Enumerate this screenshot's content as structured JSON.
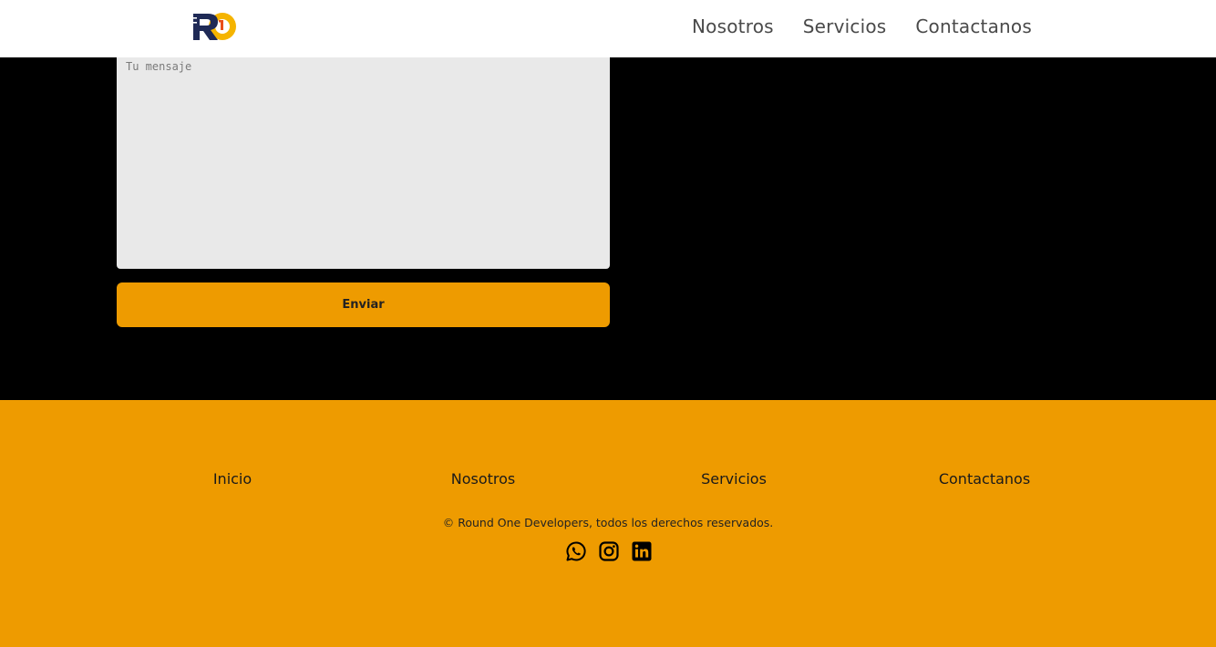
{
  "header": {
    "logo_icon": "round-one-logo",
    "nav": [
      "Nosotros",
      "Servicios",
      "Contactanos"
    ]
  },
  "contact_form": {
    "message_placeholder": "Tu mensaje",
    "message_value": "",
    "submit_label": "Enviar"
  },
  "footer": {
    "links": [
      "Inicio",
      "Nosotros",
      "Servicios",
      "Contactanos"
    ],
    "copyright": "© Round One Developers, todos los derechos reservados.",
    "socials": [
      "whatsapp-icon",
      "instagram-icon",
      "linkedin-icon"
    ]
  },
  "colors": {
    "accent": "#ee9b00",
    "logo_navy": "#1f2a56",
    "contact_bg": "#000000",
    "field_bg": "#e9e9e9",
    "header_bg": "#ffffff"
  }
}
